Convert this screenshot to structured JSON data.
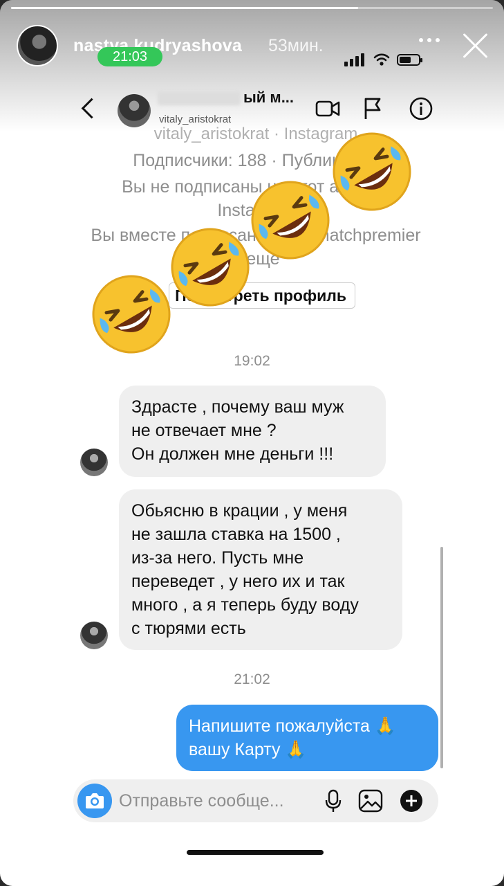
{
  "story": {
    "username": "nastya.kudryashova",
    "posted_ago": "53мин.",
    "progress": 0.72
  },
  "status_bar": {
    "time": "21:03"
  },
  "chat_header": {
    "title": "ый м...",
    "subtitle": "vitaly_aristokrat",
    "icons": [
      "back-icon",
      "video-call-icon",
      "flag-icon",
      "info-icon"
    ]
  },
  "profile_card": {
    "line1": "vitaly_aristokrat · Instagram",
    "line2": "Подписчики: 188 · Публикации",
    "line3": "Вы не подписаны на этот аккаунт",
    "line4": "Instagram",
    "line5": "Вы вместе подписаны на @matchpremier",
    "line6": "и еще",
    "view_profile_label": "Посмотреть профиль"
  },
  "messages": {
    "ts1": "19:02",
    "in1": {
      "l1": "Здрасте , почему ваш муж",
      "l2": "не отвечает мне ?",
      "l3": "Он должен мне деньги !!!"
    },
    "in2": {
      "l1": "Обьясню в крации , у меня",
      "l2": "не зашла ставка на 1500 ,",
      "l3": "из-за него. Пусть мне",
      "l4": "переведет , у него их и так",
      "l5": "много , а я теперь буду воду",
      "l6": "с тюрями есть"
    },
    "ts2": "21:02",
    "out1": {
      "l1": "Напишите пожалуйста 🙏",
      "l2": "вашу Карту 🙏"
    }
  },
  "composer": {
    "placeholder": "Отправьте сообще...",
    "icons": [
      "camera-icon",
      "microphone-icon",
      "gallery-icon",
      "add-icon"
    ]
  },
  "colors": {
    "accent": "#3897f0",
    "clock_pill": "#34c759",
    "incoming_bubble": "#efefef"
  }
}
